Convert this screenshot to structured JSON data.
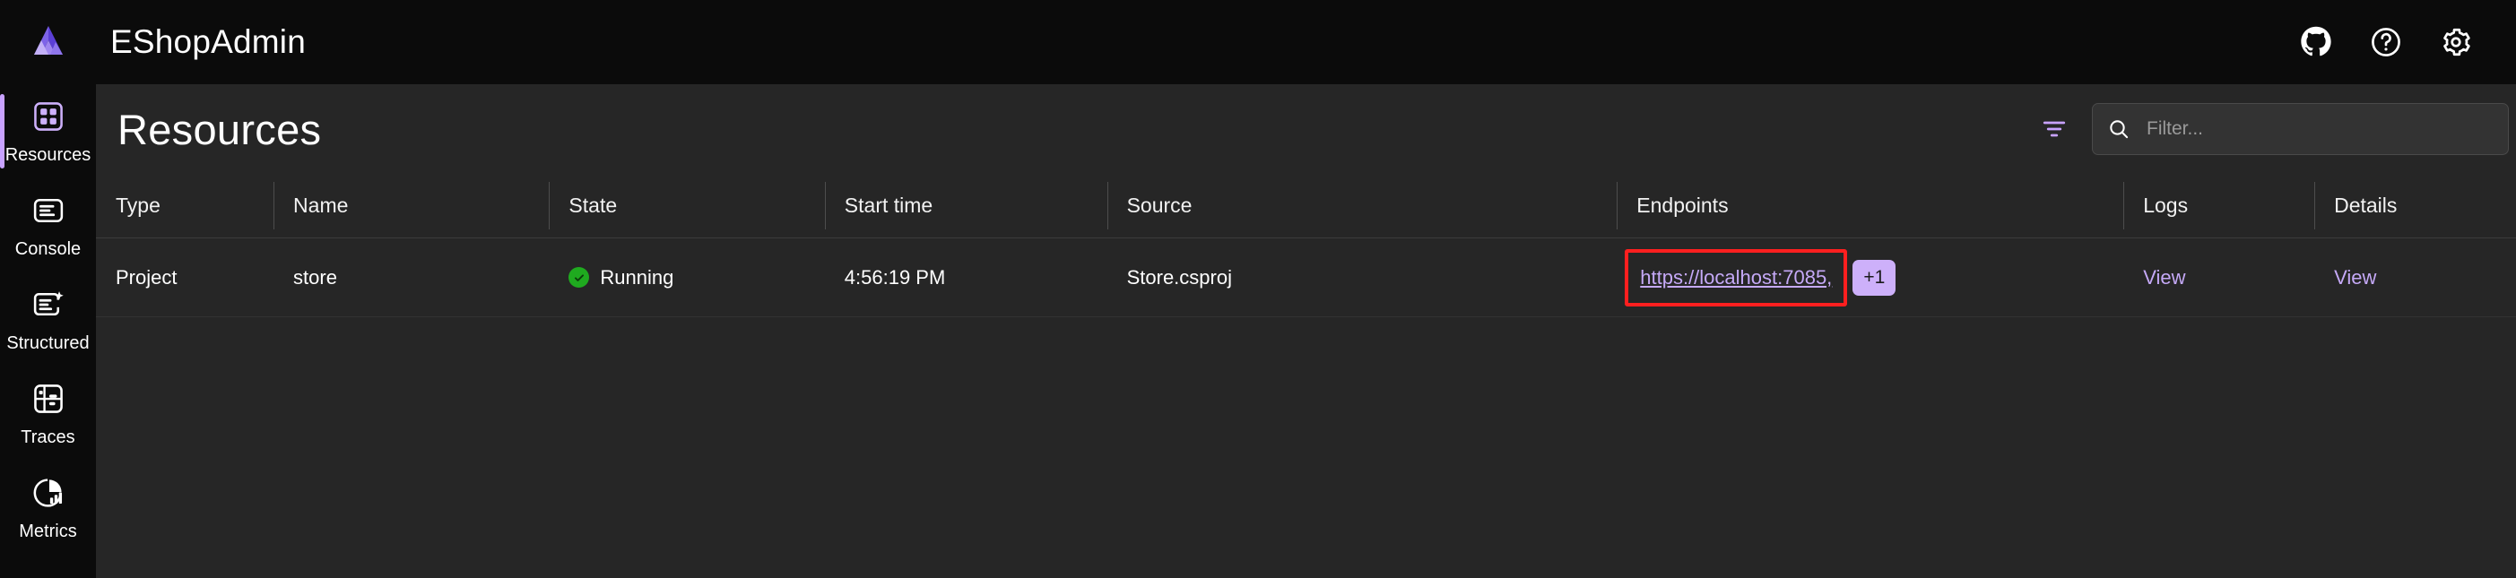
{
  "header": {
    "app_title": "EShopAdmin",
    "logo_name": "aspire-logo",
    "actions": [
      {
        "name": "github-icon",
        "label": "GitHub"
      },
      {
        "name": "help-icon",
        "label": "Help"
      },
      {
        "name": "gear-icon",
        "label": "Settings"
      }
    ]
  },
  "sidebar": {
    "items": [
      {
        "label": "Resources",
        "icon": "resources-icon",
        "active": true
      },
      {
        "label": "Console",
        "icon": "console-icon",
        "active": false
      },
      {
        "label": "Structured",
        "icon": "structured-icon",
        "active": false
      },
      {
        "label": "Traces",
        "icon": "traces-icon",
        "active": false
      },
      {
        "label": "Metrics",
        "icon": "metrics-icon",
        "active": false
      }
    ]
  },
  "main": {
    "page_title": "Resources",
    "filter_icon": "filter-icon",
    "search": {
      "placeholder": "Filter...",
      "value": "",
      "icon": "search-icon"
    },
    "table": {
      "columns": [
        "Type",
        "Name",
        "State",
        "Start time",
        "Source",
        "Endpoints",
        "Logs",
        "Details"
      ],
      "rows": [
        {
          "type": "Project",
          "name": "store",
          "state": "Running",
          "state_color": "#1faa1f",
          "start_time": "4:56:19 PM",
          "source": "Store.csproj",
          "endpoint_url": "https://localhost:7085,",
          "endpoint_more": "+1",
          "logs": "View",
          "details": "View"
        }
      ]
    }
  },
  "colors": {
    "accent": "#c8a2ff",
    "link": "#c5a9f7",
    "badge_bg": "#cdb0fa",
    "highlight": "#ff1f1f",
    "header_bg": "#0b0b0b",
    "content_bg": "#262626"
  }
}
